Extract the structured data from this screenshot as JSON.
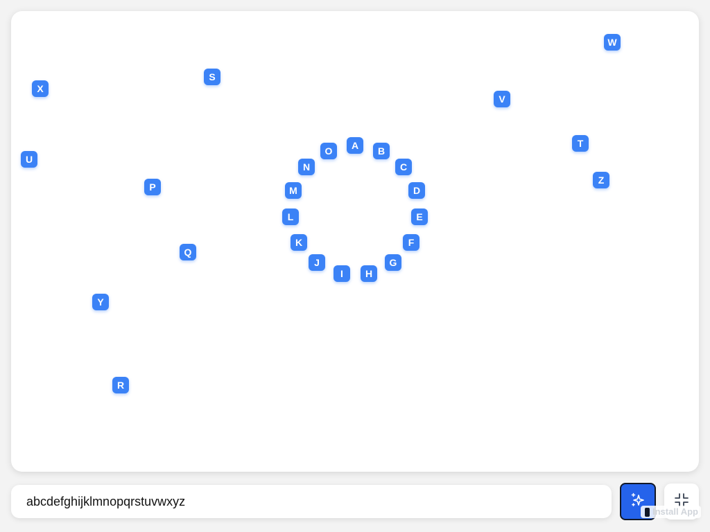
{
  "canvas": {
    "tiles": [
      {
        "label": "A"
      },
      {
        "label": "B"
      },
      {
        "label": "C"
      },
      {
        "label": "D"
      },
      {
        "label": "E"
      },
      {
        "label": "F"
      },
      {
        "label": "G"
      },
      {
        "label": "H"
      },
      {
        "label": "I"
      },
      {
        "label": "J"
      },
      {
        "label": "K"
      },
      {
        "label": "L"
      },
      {
        "label": "M"
      },
      {
        "label": "N"
      },
      {
        "label": "O"
      },
      {
        "label": "P"
      },
      {
        "label": "Q"
      },
      {
        "label": "R"
      },
      {
        "label": "S"
      },
      {
        "label": "T"
      },
      {
        "label": "U"
      },
      {
        "label": "V"
      },
      {
        "label": "W"
      },
      {
        "label": "X"
      },
      {
        "label": "Y"
      },
      {
        "label": "Z"
      }
    ]
  },
  "input": {
    "value": "abcdefghijklmnopqrstuvwxyz",
    "placeholder": ""
  },
  "buttons": {
    "magic_icon": "sparkles-icon",
    "shrink_icon": "collapse-icon"
  },
  "install_badge": {
    "label": "Install App"
  },
  "colors": {
    "tile": "#3b82f6",
    "primary_button": "#2563eb",
    "background": "#f3f3f3",
    "surface": "#ffffff"
  }
}
